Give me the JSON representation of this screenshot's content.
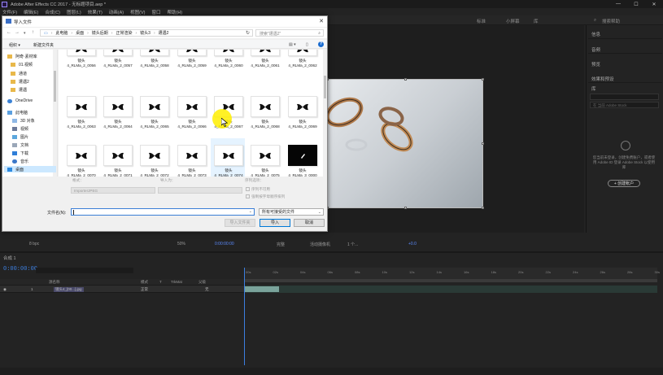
{
  "app": {
    "title": "Adobe After Effects CC 2017 - 无标题项目.aep *",
    "win_min": "—",
    "win_max": "☐",
    "win_close": "✕"
  },
  "menu": [
    "文件(F)",
    "编辑(E)",
    "合成(C)",
    "图层(L)",
    "效果(T)",
    "动画(A)",
    "视图(V)",
    "窗口",
    "帮助(H)"
  ],
  "workspace": {
    "items": [
      "标准",
      "小屏幕",
      "库"
    ],
    "search_placeholder": "搜索帮助"
  },
  "right_panel": {
    "headers": [
      "信息",
      "音频",
      "预览",
      "效果和预设",
      "库"
    ],
    "lib_search_placeholder": "在 当前 Adobe Stock",
    "cc_text": "您当前未登录，创建免费账户，或者使用 Adobe ID 登录 Adobe Stock 以使用库",
    "cc_button": "+ 创建帐户"
  },
  "viewer_toolbar": {
    "bit_depth": "8 bpc",
    "zoom": "50%",
    "timecode": "0:00:00:00",
    "resolution": "完整",
    "camera": "活动摄像机",
    "views": "1 个...",
    "offset": "+0.0"
  },
  "dialog": {
    "title": "导入文件",
    "close": "✕",
    "breadcrumbs": [
      "此电脑",
      "桌面",
      "镜头后期",
      "正常渲染",
      "镜头3",
      "遭遇2"
    ],
    "search_placeholder": "搜索\"遭遇2\"",
    "organize": "组织 ▾",
    "new_folder": "新建文件夹",
    "nav_items": [
      {
        "label": "阿奇·素材库",
        "icon": "folder"
      },
      {
        "label": "01.视频",
        "icon": "folder"
      },
      {
        "label": "通道",
        "icon": "folder"
      },
      {
        "label": "遭遇2",
        "icon": "folder"
      },
      {
        "label": "遭遇",
        "icon": "folder"
      },
      {
        "label": "OneDrive",
        "icon": "cloud"
      },
      {
        "label": "此电脑",
        "icon": "pc"
      },
      {
        "label": "3D 对象",
        "icon": "obj"
      },
      {
        "label": "视频",
        "icon": "video"
      },
      {
        "label": "图片",
        "icon": "pic"
      },
      {
        "label": "文档",
        "icon": "doc"
      },
      {
        "label": "下载",
        "icon": "down"
      },
      {
        "label": "音乐",
        "icon": "music"
      },
      {
        "label": "桌面",
        "icon": "desk"
      }
    ],
    "files": [
      {
        "prefix": "镜头",
        "name": "4_RLMa_2_0056"
      },
      {
        "prefix": "镜头",
        "name": "4_RLMa_2_0057"
      },
      {
        "prefix": "镜头",
        "name": "4_RLMa_2_0058"
      },
      {
        "prefix": "镜头",
        "name": "4_RLMa_2_0059"
      },
      {
        "prefix": "镜头",
        "name": "4_RLMa_2_0060"
      },
      {
        "prefix": "镜头",
        "name": "4_RLMa_2_0061"
      },
      {
        "prefix": "镜头",
        "name": "4_RLMa_2_0062"
      },
      {
        "prefix": "镜头",
        "name": "4_RLMa_2_0063"
      },
      {
        "prefix": "镜头",
        "name": "4_RLMa_2_0064"
      },
      {
        "prefix": "镜头",
        "name": "4_RLMa_2_0065"
      },
      {
        "prefix": "镜头",
        "name": "4_RLMa_2_0066"
      },
      {
        "prefix": "镜头",
        "name": "4_RLMa_2_0067"
      },
      {
        "prefix": "镜头",
        "name": "4_RLMa_2_0068"
      },
      {
        "prefix": "镜头",
        "name": "4_RLMa_2_0069"
      },
      {
        "prefix": "镜头",
        "name": "4_RLMa_2_0070"
      },
      {
        "prefix": "镜头",
        "name": "4_RLMa_2_0071"
      },
      {
        "prefix": "镜头",
        "name": "4_RLMa_2_0072"
      },
      {
        "prefix": "镜头",
        "name": "4_RLMa_2_0073"
      },
      {
        "prefix": "镜头",
        "name": "4_RLMa_2_0074"
      },
      {
        "prefix": "镜头",
        "name": "4_RLMa_2_0075"
      },
      {
        "prefix": "镜头",
        "name": "4_RLMa_3_0000"
      }
    ],
    "options": {
      "format_label": "格式：",
      "format_value": "ImporterJPEG",
      "import_as_label": "导入为：",
      "sequence_label": "序列选项：",
      "sequence_check": "序列不可用",
      "alpha_check": "强制按字母顺序排列"
    },
    "filename_label": "文件名(N):",
    "filename_value": "",
    "filter_value": "所有可接受的文件",
    "btn_import_folder": "导入文件夹",
    "btn_import": "导入",
    "btn_cancel": "取消"
  },
  "timeline": {
    "tab": "合成 1",
    "timecode": "0:00:00:00",
    "columns": [
      "源名称",
      "模式",
      "T",
      "TrkMat",
      "父级"
    ],
    "layer": {
      "index": "1",
      "name": "镜头4_[00...].jpg",
      "mode": "正常",
      "parent": "无"
    },
    "ruler": [
      "00s",
      "02s",
      "04s",
      "06s",
      "08s",
      "10s",
      "12s",
      "14s",
      "16s",
      "18s",
      "20s",
      "22s",
      "24s",
      "26s",
      "28s",
      "30s"
    ]
  },
  "colors": {
    "accent_blue": "#3c7fe0",
    "timeline_bar": "#7aa39b",
    "cursor_highlight": "#ffee00"
  }
}
